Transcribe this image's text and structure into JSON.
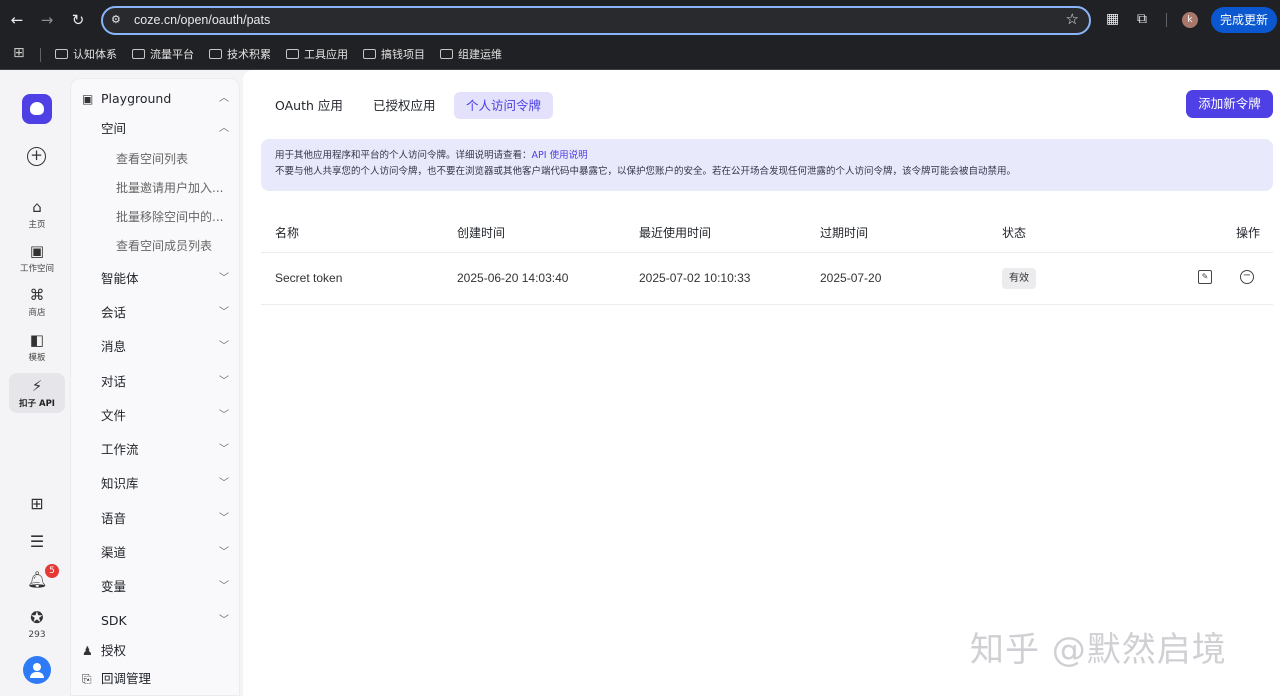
{
  "browser": {
    "url": "coze.cn/open/oauth/pats",
    "update_label": "完成更新",
    "profile_initial": "k",
    "bookmarks": [
      "认知体系",
      "流量平台",
      "技术积累",
      "工具应用",
      "搞钱项目",
      "组建运维"
    ]
  },
  "rail": {
    "items": [
      {
        "label": "主页",
        "icon": "home-icon"
      },
      {
        "label": "工作空间",
        "icon": "workspace-icon"
      },
      {
        "label": "商店",
        "icon": "store-icon"
      },
      {
        "label": "模板",
        "icon": "template-icon"
      },
      {
        "label": "扣子 API",
        "icon": "api-icon"
      }
    ],
    "notification_count": "5",
    "stat_count": "293"
  },
  "tree": {
    "root": "Playground",
    "space": "空间",
    "space_children": [
      "查看空间列表",
      "批量邀请用户加入...",
      "批量移除空间中的...",
      "查看空间成员列表"
    ],
    "sections": [
      "智能体",
      "会话",
      "消息",
      "对话",
      "文件",
      "工作流",
      "知识库",
      "语音",
      "渠道",
      "变量",
      "SDK"
    ],
    "auth": "授权",
    "callback": "回调管理"
  },
  "main": {
    "tabs": [
      "OAuth 应用",
      "已授权应用",
      "个人访问令牌"
    ],
    "active_tab": "个人访问令牌",
    "add_button": "添加新令牌",
    "notice_line1_prefix": "用于其他应用程序和平台的个人访问令牌。详细说明请查看：",
    "notice_link": "API 使用说明",
    "notice_line2": "不要与他人共享您的个人访问令牌，也不要在浏览器或其他客户端代码中暴露它，以保护您账户的安全。若在公开场合发现任何泄露的个人访问令牌，该令牌可能会被自动禁用。",
    "columns": [
      "名称",
      "创建时间",
      "最近使用时间",
      "过期时间",
      "状态",
      "操作"
    ],
    "rows": [
      {
        "name": "Secret token",
        "created": "2025-06-20 14:03:40",
        "last_used": "2025-07-02 10:10:33",
        "expires": "2025-07-20",
        "status": "有效"
      }
    ]
  },
  "watermark": "知乎 @默然启境"
}
